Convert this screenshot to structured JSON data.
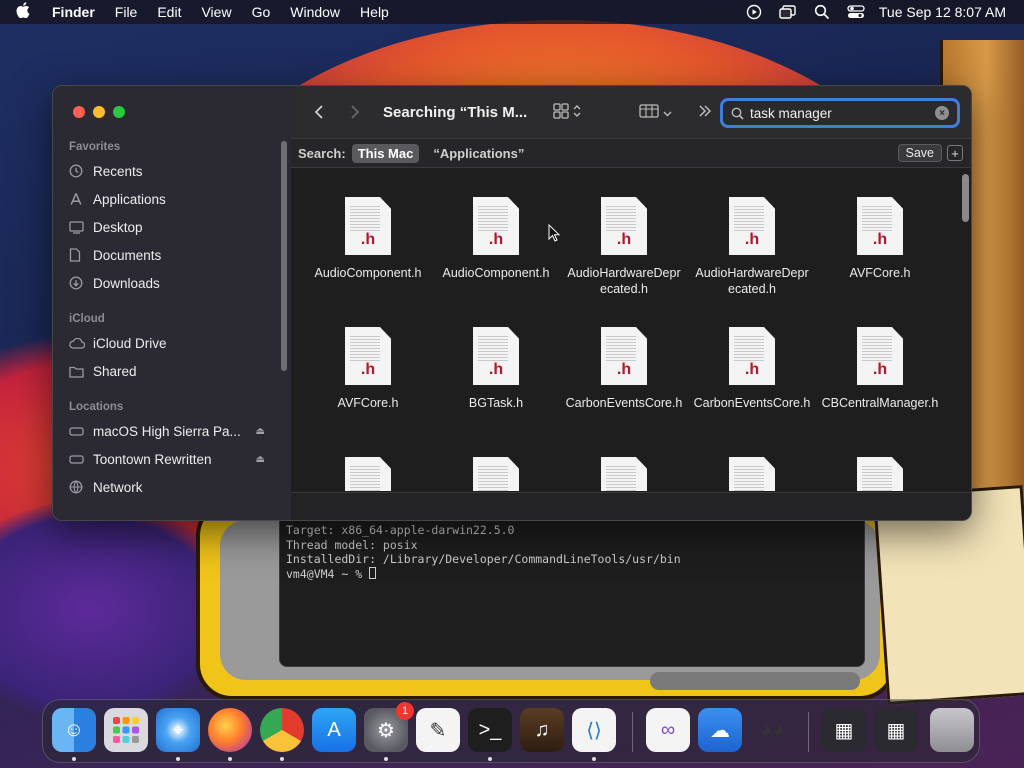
{
  "menubar": {
    "app_name": "Finder",
    "items": [
      "File",
      "Edit",
      "View",
      "Go",
      "Window",
      "Help"
    ],
    "clock": "Tue Sep 12  8:07 AM"
  },
  "finder": {
    "title": "Searching “This M...",
    "search_value": "task manager",
    "scope_label": "Search:",
    "scope_this_mac": "This Mac",
    "scope_applications": "“Applications”",
    "save_label": "Save",
    "plus_label": "+",
    "sidebar": {
      "favorites_header": "Favorites",
      "favorites": [
        "Recents",
        "Applications",
        "Desktop",
        "Documents",
        "Downloads"
      ],
      "icloud_header": "iCloud",
      "icloud": [
        "iCloud Drive",
        "Shared"
      ],
      "locations_header": "Locations",
      "locations": [
        "macOS High Sierra Pa...",
        "Toontown Rewritten",
        "Network"
      ]
    },
    "files": [
      "AudioComponent.h",
      "AudioComponent.h",
      "AudioHardwareDeprecated.h",
      "AudioHardwareDeprecated.h",
      "AVFCore.h",
      "AVFCore.h",
      "BGTask.h",
      "CarbonEventsCore.h",
      "CarbonEventsCore.h",
      "CBCentralManager.h",
      "",
      "",
      "",
      "",
      ""
    ],
    "file_ext_label": ".h"
  },
  "terminal": {
    "lines": [
      "Target: x86_64-apple-darwin22.5.0",
      "Thread model: posix",
      "InstalledDir: /Library/Developer/CommandLineTools/usr/bin",
      "vm4@VM4 ~ % "
    ]
  },
  "dock": {
    "badge_count": "1",
    "apps": [
      "Finder",
      "Launchpad",
      "Safari",
      "Firefox",
      "Chrome",
      "App Store",
      "System Settings",
      "TextEdit",
      "Terminal",
      "GarageBand",
      "VS Code",
      "Visual Studio",
      "Weather",
      "Toontown",
      "Windows",
      "Windows",
      "Trash"
    ]
  }
}
